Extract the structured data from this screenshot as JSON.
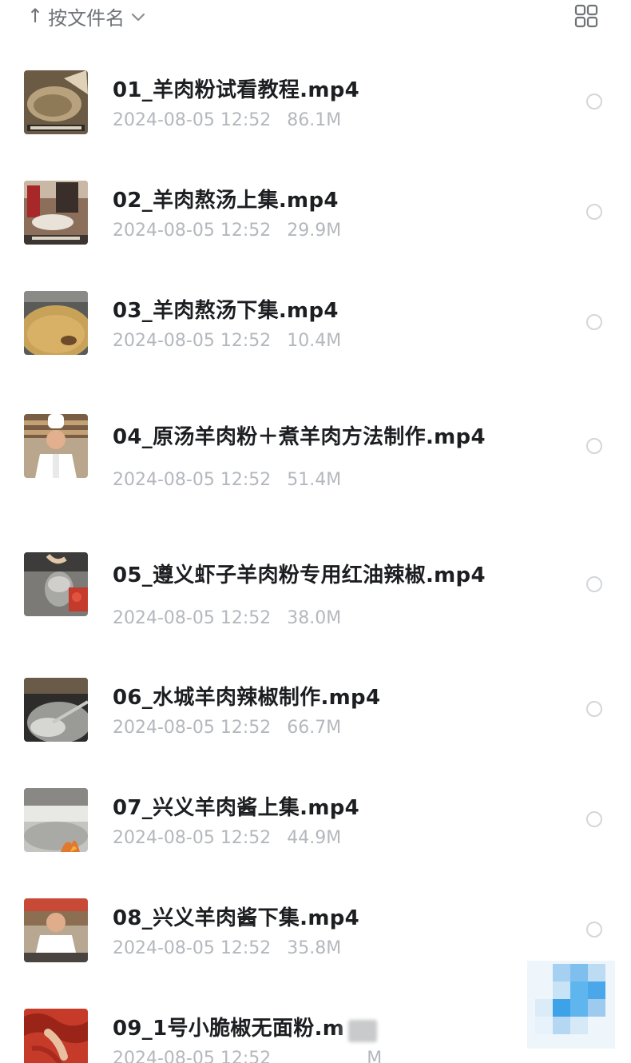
{
  "header": {
    "sort_arrow": "↑",
    "sort_label": "按文件名",
    "grid_icon": "grid-icon"
  },
  "files": [
    {
      "name": "01_羊肉粉试看教程.mp4",
      "date": "2024-08-05 12:52",
      "size": "86.1M",
      "thumb_icon": "video-thumbnail-icon"
    },
    {
      "name": "02_羊肉熬汤上集.mp4",
      "date": "2024-08-05 12:52",
      "size": "29.9M",
      "thumb_icon": "video-thumbnail-icon"
    },
    {
      "name": "03_羊肉熬汤下集.mp4",
      "date": "2024-08-05 12:52",
      "size": "10.4M",
      "thumb_icon": "video-thumbnail-icon"
    },
    {
      "name": "04_原汤羊肉粉＋煮羊肉方法制作.mp4",
      "date": "2024-08-05 12:52",
      "size": "51.4M",
      "thumb_icon": "video-thumbnail-icon"
    },
    {
      "name": "05_遵义虾子羊肉粉专用红油辣椒.mp4",
      "date": "2024-08-05 12:52",
      "size": "38.0M",
      "thumb_icon": "video-thumbnail-icon"
    },
    {
      "name": "06_水城羊肉辣椒制作.mp4",
      "date": "2024-08-05 12:52",
      "size": "66.7M",
      "thumb_icon": "video-thumbnail-icon"
    },
    {
      "name": "07_兴义羊肉酱上集.mp4",
      "date": "2024-08-05 12:52",
      "size": "44.9M",
      "thumb_icon": "video-thumbnail-icon"
    },
    {
      "name": "08_兴义羊肉酱下集.mp4",
      "date": "2024-08-05 12:52",
      "size": "35.8M",
      "thumb_icon": "video-thumbnail-icon"
    },
    {
      "name": "09_1号小脆椒无面粉.m",
      "date": "2024-08-05 12:52",
      "size": "M",
      "thumb_icon": "video-thumbnail-icon"
    }
  ],
  "colors": {
    "name_text": "#1c1e21",
    "meta_text": "#b4b8bd",
    "header_text": "#6f7378",
    "radio_border": "#d3d6da",
    "mosaic_blue": "#5fb6ee"
  }
}
